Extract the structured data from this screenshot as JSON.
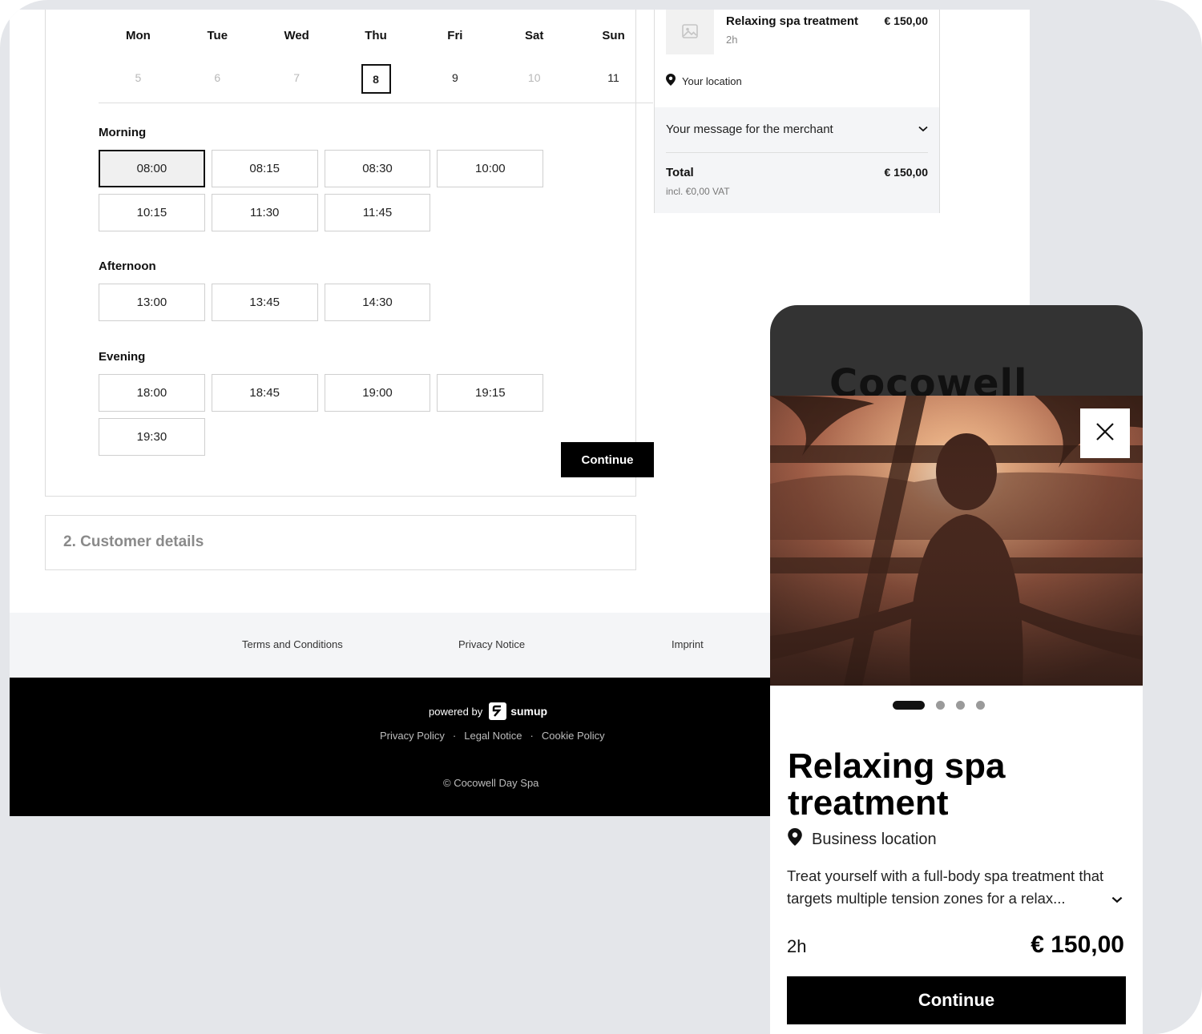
{
  "calendar": {
    "days": [
      {
        "name": "Mon",
        "num": "5",
        "state": "disabled"
      },
      {
        "name": "Tue",
        "num": "6",
        "state": "disabled"
      },
      {
        "name": "Wed",
        "num": "7",
        "state": "disabled"
      },
      {
        "name": "Thu",
        "num": "8",
        "state": "selected"
      },
      {
        "name": "Fri",
        "num": "9",
        "state": "available"
      },
      {
        "name": "Sat",
        "num": "10",
        "state": "disabled"
      },
      {
        "name": "Sun",
        "num": "11",
        "state": "available"
      }
    ]
  },
  "slots": {
    "morning": {
      "title": "Morning",
      "times": [
        "08:00",
        "08:15",
        "08:30",
        "10:00",
        "10:15",
        "11:30",
        "11:45"
      ],
      "selected": "08:00"
    },
    "afternoon": {
      "title": "Afternoon",
      "times": [
        "13:00",
        "13:45",
        "14:30"
      ]
    },
    "evening": {
      "title": "Evening",
      "times": [
        "18:00",
        "18:45",
        "19:00",
        "19:15",
        "19:30"
      ]
    }
  },
  "booking": {
    "continue_label": "Continue"
  },
  "customer": {
    "title": "2. Customer details"
  },
  "summary": {
    "service_name": "Relaxing spa treatment",
    "duration": "2h",
    "price": "€ 150,00",
    "location": "Your location",
    "message_label": "Your message for the merchant",
    "total_label": "Total",
    "total_value": "€ 150,00",
    "vat": "incl. €0,00 VAT"
  },
  "footer": {
    "links": [
      "Terms and Conditions",
      "Privacy Notice",
      "Imprint"
    ],
    "powered_by": "powered by",
    "brand": "sumup",
    "legal": [
      "Privacy Policy",
      "Legal Notice",
      "Cookie Policy"
    ],
    "separator": "·",
    "copyright": "© Cocowell Day Spa"
  },
  "mobile": {
    "brand": "Cocowell",
    "title": "Relaxing spa treatment",
    "location": "Business location",
    "description": "Treat yourself with a full-body spa treatment that targets multiple tension zones for a relax...",
    "duration": "2h",
    "price": "€ 150,00",
    "continue_label": "Continue",
    "carousel_total": 4,
    "carousel_active": 0
  },
  "icons": [
    "image-placeholder-icon",
    "location-pin-icon",
    "chevron-down-icon",
    "close-icon",
    "sumup-logo-icon"
  ]
}
